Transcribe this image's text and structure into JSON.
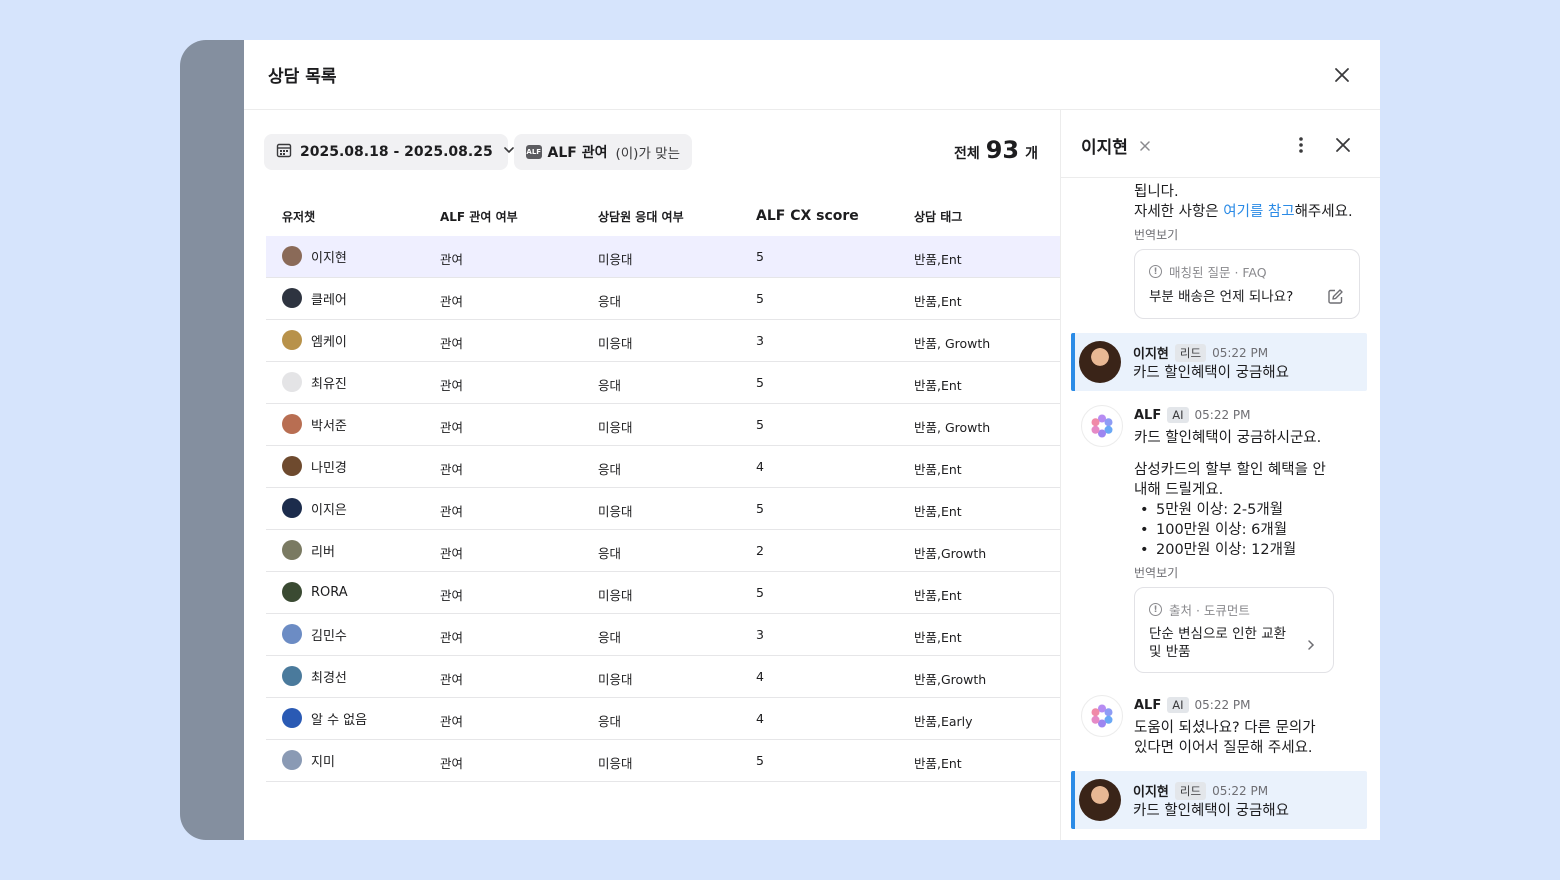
{
  "modal": {
    "title": "상담 목록"
  },
  "filters": {
    "date_range": "2025.08.18 - 2025.08.25",
    "alf_badge": "ALF",
    "alf_label": "ALF 관여",
    "alf_condition": "(이)가 맞는",
    "total_label": "전체",
    "total_count": "93",
    "total_unit": "개"
  },
  "table": {
    "headers": [
      "유저챗",
      "ALF 관여 여부",
      "상담원 응대 여부",
      "ALF CX score",
      "상담 태그"
    ],
    "rows": [
      {
        "user": "이지현",
        "alf": "관여",
        "agent": "미응대",
        "score": "5",
        "tag": "반품,Ent",
        "color": "#8a6a58"
      },
      {
        "user": "클레어",
        "alf": "관여",
        "agent": "응대",
        "score": "5",
        "tag": "반품,Ent",
        "color": "#2e3440"
      },
      {
        "user": "엠케이",
        "alf": "관여",
        "agent": "미응대",
        "score": "3",
        "tag": "반품, Growth",
        "color": "#b8924a"
      },
      {
        "user": "최유진",
        "alf": "관여",
        "agent": "응대",
        "score": "5",
        "tag": "반품,Ent",
        "color": "#e4e4e6"
      },
      {
        "user": "박서준",
        "alf": "관여",
        "agent": "미응대",
        "score": "5",
        "tag": "반품, Growth",
        "color": "#b86e52"
      },
      {
        "user": "나민경",
        "alf": "관여",
        "agent": "응대",
        "score": "4",
        "tag": "반품,Ent",
        "color": "#6e4a2e"
      },
      {
        "user": "이지은",
        "alf": "관여",
        "agent": "미응대",
        "score": "5",
        "tag": "반품,Ent",
        "color": "#1c2c4c"
      },
      {
        "user": "리버",
        "alf": "관여",
        "agent": "응대",
        "score": "2",
        "tag": "반품,Growth",
        "color": "#7a7a62"
      },
      {
        "user": "RORA",
        "alf": "관여",
        "agent": "미응대",
        "score": "5",
        "tag": "반품,Ent",
        "color": "#3a4a32"
      },
      {
        "user": "김민수",
        "alf": "관여",
        "agent": "응대",
        "score": "3",
        "tag": "반품,Ent",
        "color": "#6c8cc4"
      },
      {
        "user": "최경선",
        "alf": "관여",
        "agent": "미응대",
        "score": "4",
        "tag": "반품,Growth",
        "color": "#4a7a9c"
      },
      {
        "user": "알 수 없음",
        "alf": "관여",
        "agent": "응대",
        "score": "4",
        "tag": "반품,Early",
        "color": "#2a5ab4"
      },
      {
        "user": "지미",
        "alf": "관여",
        "agent": "미응대",
        "score": "5",
        "tag": "반품,Ent",
        "color": "#8a9ab4"
      }
    ]
  },
  "chat": {
    "name": "이지현",
    "msg0": {
      "line1": "됩니다.",
      "line2_pre": "자세한 사항은 ",
      "line2_link": "여기를 참고",
      "line2_post": "해주세요.",
      "translate": "번역보기",
      "ref_label": "매칭된 질문 · FAQ",
      "ref_text": "부분 배송은 언제 되나요?"
    },
    "msg1": {
      "name": "이지현",
      "badge": "리드",
      "time": "05:22 PM",
      "text": "카드 할인혜택이 궁금해요"
    },
    "msg2": {
      "name": "ALF",
      "badge": "AI",
      "time": "05:22 PM",
      "line1": "카드 할인혜택이 궁금하시군요.",
      "para_a": "삼성카드의 할부 할인 혜택을 안",
      "para_b": "내해 드릴게요.",
      "bullets": [
        "5만원 이상: 2-5개월",
        "100만원 이상: 6개월",
        "200만원 이상: 12개월"
      ],
      "translate": "번역보기",
      "ref_label": "출처 · 도큐먼트",
      "ref_line1": "단순 변심으로 인한 교환",
      "ref_line2": "및 반품"
    },
    "msg3": {
      "name": "ALF",
      "badge": "AI",
      "time": "05:22 PM",
      "line1": "도움이 되셨나요? 다른 문의가",
      "line2": "있다면 이어서 질문해 주세요."
    },
    "msg4": {
      "name": "이지현",
      "badge": "리드",
      "time": "05:22 PM",
      "text": "카드 할인혜택이 궁금해요"
    }
  },
  "colors": {
    "accent": "#2b8be6",
    "selected_row": "#efefff",
    "lead_bg": "#eaf2fc"
  }
}
